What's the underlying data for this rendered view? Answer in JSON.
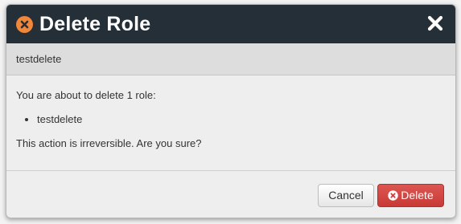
{
  "dialog": {
    "title": "Delete Role",
    "subheader": "testdelete",
    "message": "You are about to delete 1 role:",
    "items": [
      "testdelete"
    ],
    "warning": "This action is irreversible. Are you sure?",
    "cancel_label": "Cancel",
    "delete_label": "Delete"
  },
  "icons": {
    "title": "x-circle-icon",
    "close": "close-icon",
    "delete": "x-circle-icon"
  },
  "colors": {
    "header_bg": "#252f37",
    "title_icon": "#f0873a",
    "delete_button": "#d9534f"
  }
}
